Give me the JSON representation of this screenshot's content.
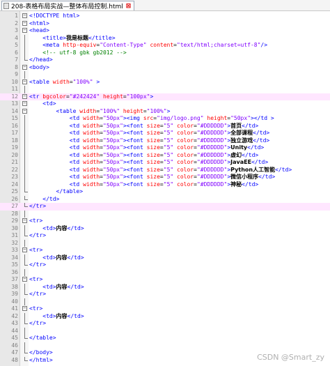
{
  "tab": {
    "title": "208-表格布局实战—整体布局控制.html",
    "close": "⊠"
  },
  "watermark": "CSDN @Smart_zy",
  "colors": {
    "tag": "#0000ff",
    "attr": "#ff0000",
    "value": "#8000ff",
    "comment": "#008000",
    "highlight": "#ffe6ff"
  },
  "lines": [
    {
      "n": "1",
      "fold": "minus",
      "code": "<!DOCTYPE html>"
    },
    {
      "n": "2",
      "fold": "minus",
      "code": "<html>"
    },
    {
      "n": "3",
      "fold": "minus",
      "code": "<head>"
    },
    {
      "n": "4",
      "fold": "bar",
      "code": "    <title>我是标题</title>"
    },
    {
      "n": "5",
      "fold": "bar",
      "code": "    <meta http-equiv=\"Content-Type\" content=\"text/html;charset=utf-8\"/>"
    },
    {
      "n": "6",
      "fold": "bar",
      "code": "    <!-- utf-8 gbk gb2012 -->"
    },
    {
      "n": "7",
      "fold": "end",
      "code": "</head>"
    },
    {
      "n": "8",
      "fold": "minus",
      "code": "<body>"
    },
    {
      "n": "9",
      "fold": "bar",
      "code": ""
    },
    {
      "n": "10",
      "fold": "minus",
      "code": "<table width=\"100%\" >"
    },
    {
      "n": "11",
      "fold": "bar",
      "code": ""
    },
    {
      "n": "12",
      "fold": "minus",
      "code": "<tr bgcolor=\"#242424\" height=\"100px\">",
      "hl": true
    },
    {
      "n": "13",
      "fold": "minus",
      "code": "    <td>"
    },
    {
      "n": "14",
      "fold": "minus",
      "code": "        <table width=\"100%\" height=\"100%\">"
    },
    {
      "n": "15",
      "fold": "bar",
      "code": "            <td width=\"50px\"><img src=\"img/logo.png\" height=\"50px\"></td >"
    },
    {
      "n": "16",
      "fold": "bar",
      "code": "            <td width=\"50px\"><font size=\"5\" color=\"#DDDDDD\">首页</td>"
    },
    {
      "n": "17",
      "fold": "bar",
      "code": "            <td width=\"50px\"><font size=\"5\" color=\"#DDDDDD\">全部课程</td>"
    },
    {
      "n": "18",
      "fold": "bar",
      "code": "            <td width=\"50px\"><font size=\"5\" color=\"#DDDDDD\">独立游戏</td>"
    },
    {
      "n": "19",
      "fold": "bar",
      "code": "            <td width=\"50px\"><font size=\"5\" color=\"#DDDDDD\">Unity</td>"
    },
    {
      "n": "20",
      "fold": "bar",
      "code": "            <td width=\"50px\"><font size=\"5\" color=\"#DDDDDD\">虚幻</td>"
    },
    {
      "n": "21",
      "fold": "bar",
      "code": "            <td width=\"50px\"><font size=\"5\" color=\"#DDDDDD\">JavaEE</td>"
    },
    {
      "n": "22",
      "fold": "bar",
      "code": "            <td width=\"50px\"><font size=\"5\" color=\"#DDDDDD\">Python人工智能</td>"
    },
    {
      "n": "23",
      "fold": "bar",
      "code": "            <td width=\"50px\"><font size=\"5\" color=\"#DDDDDD\">微信小程序</td>"
    },
    {
      "n": "24",
      "fold": "bar",
      "code": "            <td width=\"50px\"><font size=\"5\" color=\"#DDDDDD\">神秘</td>"
    },
    {
      "n": "25",
      "fold": "end",
      "code": "        </table>"
    },
    {
      "n": "26",
      "fold": "end",
      "code": "    </td>"
    },
    {
      "n": "27",
      "fold": "end",
      "code": "</tr>",
      "hl": true
    },
    {
      "n": "28",
      "fold": "bar",
      "code": ""
    },
    {
      "n": "29",
      "fold": "minus",
      "code": "<tr>"
    },
    {
      "n": "30",
      "fold": "bar",
      "code": "    <td>内容</td>"
    },
    {
      "n": "31",
      "fold": "end",
      "code": "</tr>"
    },
    {
      "n": "32",
      "fold": "bar",
      "code": ""
    },
    {
      "n": "33",
      "fold": "minus",
      "code": "<tr>"
    },
    {
      "n": "34",
      "fold": "bar",
      "code": "    <td>内容</td>"
    },
    {
      "n": "35",
      "fold": "end",
      "code": "</tr>"
    },
    {
      "n": "36",
      "fold": "bar",
      "code": ""
    },
    {
      "n": "37",
      "fold": "minus",
      "code": "<tr>"
    },
    {
      "n": "38",
      "fold": "bar",
      "code": "    <td>内容</td>"
    },
    {
      "n": "39",
      "fold": "end",
      "code": "</tr>"
    },
    {
      "n": "40",
      "fold": "bar",
      "code": ""
    },
    {
      "n": "41",
      "fold": "minus",
      "code": "<tr>"
    },
    {
      "n": "42",
      "fold": "bar",
      "code": "    <td>内容</td>"
    },
    {
      "n": "43",
      "fold": "end",
      "code": "</tr>"
    },
    {
      "n": "44",
      "fold": "bar",
      "code": ""
    },
    {
      "n": "45",
      "fold": "end",
      "code": "</table>"
    },
    {
      "n": "46",
      "fold": "bar",
      "code": ""
    },
    {
      "n": "47",
      "fold": "end",
      "code": "</body>"
    },
    {
      "n": "48",
      "fold": "end",
      "code": "</html>"
    }
  ]
}
